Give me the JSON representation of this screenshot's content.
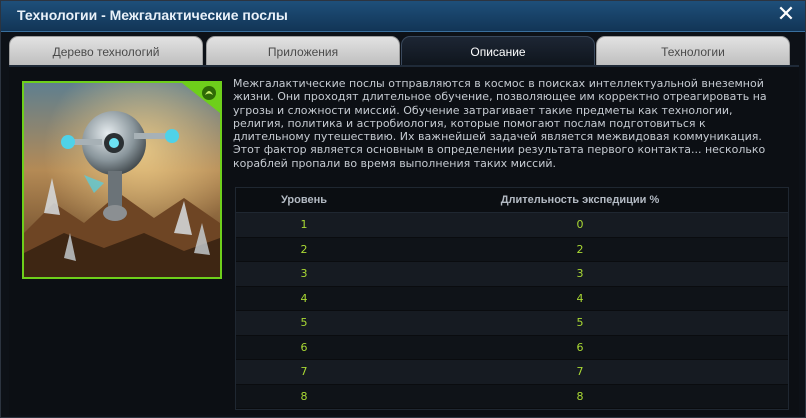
{
  "window": {
    "title": "Технологии - Межгалактические послы",
    "close_label": "✕"
  },
  "tabs": [
    {
      "label": "Дерево технологий",
      "active": false
    },
    {
      "label": "Приложения",
      "active": false
    },
    {
      "label": "Описание",
      "active": true
    },
    {
      "label": "Технологии",
      "active": false
    }
  ],
  "description": "Межгалактические послы отправляются в космос в поисках интеллектуальной внеземной жизни. Они проходят длительное обучение, позволяющее им корректно отреагировать на угрозы и сложности миссий. Обучение затрагивает такие предметы как технологии, религия, политика и астробиология, которые помогают послам подготовиться к длительному путешествию. Их важнейшей задачей является межвидовая коммуникация. Этот фактор является основным в определении результата первого контакта... несколько кораблей пропали во время выполнения таких миссий.",
  "table": {
    "headers": [
      "Уровень",
      "Длительность экспедиции %"
    ],
    "rows": [
      [
        "1",
        "0"
      ],
      [
        "2",
        "2"
      ],
      [
        "3",
        "3"
      ],
      [
        "4",
        "4"
      ],
      [
        "5",
        "5"
      ],
      [
        "6",
        "6"
      ],
      [
        "7",
        "7"
      ],
      [
        "8",
        "8"
      ]
    ]
  },
  "colors": {
    "accent_green": "#6ecf1b",
    "value_green": "#a9d934",
    "titlebar_blue": "#1e4f7a"
  },
  "icons": {
    "badge": "leaf-badge-icon",
    "close": "close-icon"
  }
}
